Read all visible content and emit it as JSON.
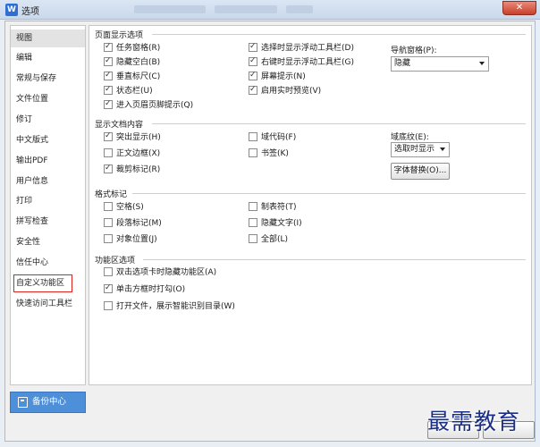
{
  "window": {
    "title": "选项",
    "close_label": "✕"
  },
  "sidebar": {
    "items": [
      {
        "label": "视图"
      },
      {
        "label": "编辑"
      },
      {
        "label": "常规与保存"
      },
      {
        "label": "文件位置"
      },
      {
        "label": "修订"
      },
      {
        "label": "中文版式"
      },
      {
        "label": "输出PDF"
      },
      {
        "label": "用户信息"
      },
      {
        "label": "打印"
      },
      {
        "label": "拼写检查"
      },
      {
        "label": "安全性"
      },
      {
        "label": "信任中心"
      },
      {
        "label": "自定义功能区"
      },
      {
        "label": "快速访问工具栏"
      }
    ],
    "active_index": 0,
    "highlight_index": 12
  },
  "backup": {
    "label": "备份中心"
  },
  "sections": {
    "page_display": {
      "title": "页面显示选项",
      "options": [
        {
          "label": "任务窗格(R)",
          "checked": true
        },
        {
          "label": "隐藏空白(B)",
          "checked": true
        },
        {
          "label": "垂直标尺(C)",
          "checked": true
        },
        {
          "label": "状态栏(U)",
          "checked": true
        },
        {
          "label": "进入页眉页脚提示(Q)",
          "checked": true
        },
        {
          "label": "选择时显示浮动工具栏(D)",
          "checked": true
        },
        {
          "label": "右键时显示浮动工具栏(G)",
          "checked": true
        },
        {
          "label": "屏幕提示(N)",
          "checked": true
        },
        {
          "label": "启用实时预览(V)",
          "checked": true
        }
      ],
      "nav_pane": {
        "label": "导航窗格(P):",
        "value": "隐藏"
      }
    },
    "doc_content": {
      "title": "显示文档内容",
      "options": [
        {
          "label": "突出显示(H)",
          "checked": true
        },
        {
          "label": "正文边框(X)",
          "checked": false
        },
        {
          "label": "裁剪标记(R)",
          "checked": true
        },
        {
          "label": "域代码(F)",
          "checked": false
        },
        {
          "label": "书签(K)",
          "checked": false
        }
      ],
      "field_shading": {
        "label": "域底纹(E):",
        "value": "选取时显示"
      },
      "font_replace_label": "字体替换(O)..."
    },
    "format_marks": {
      "title": "格式标记",
      "options": [
        {
          "label": "空格(S)",
          "checked": false
        },
        {
          "label": "段落标记(M)",
          "checked": false
        },
        {
          "label": "对象位置(J)",
          "checked": false
        },
        {
          "label": "制表符(T)",
          "checked": false
        },
        {
          "label": "隐藏文字(I)",
          "checked": false
        },
        {
          "label": "全部(L)",
          "checked": false
        }
      ]
    },
    "ribbon": {
      "title": "功能区选项",
      "options": [
        {
          "label": "双击选项卡时隐藏功能区(A)",
          "checked": false
        },
        {
          "label": "单击方框时打勾(O)",
          "checked": true
        },
        {
          "label": "打开文件，展示智能识别目录(W)",
          "checked": false
        }
      ]
    }
  },
  "watermark": {
    "text": "最需教育"
  }
}
